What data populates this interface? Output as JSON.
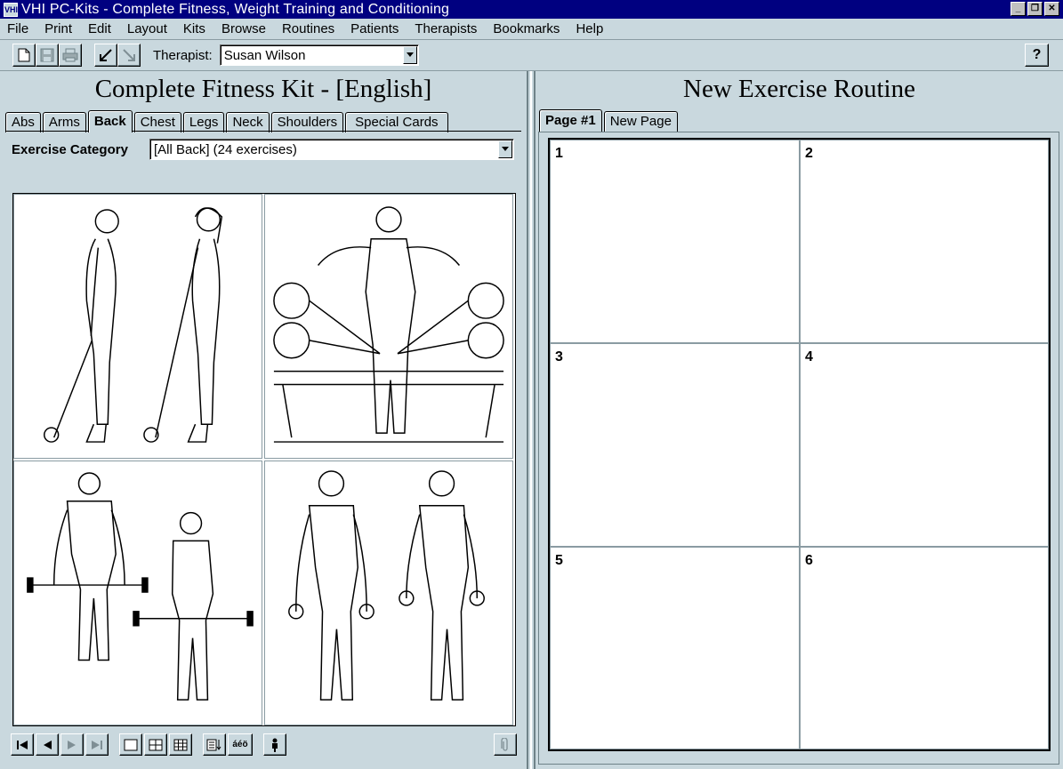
{
  "window": {
    "title": "VHI PC-Kits - Complete Fitness, Weight Training and Conditioning",
    "app_icon_text": "VHI"
  },
  "menu": [
    "File",
    "Print",
    "Edit",
    "Layout",
    "Kits",
    "Browse",
    "Routines",
    "Patients",
    "Therapists",
    "Bookmarks",
    "Help"
  ],
  "toolbar": {
    "therapist_label": "Therapist:",
    "therapist_value": "Susan Wilson",
    "help_label": "?"
  },
  "kit": {
    "title": "Complete Fitness Kit - [English]",
    "tabs": [
      "Abs",
      "Arms",
      "Back",
      "Chest",
      "Legs",
      "Neck",
      "Shoulders",
      "Special Cards"
    ],
    "active_tab": "Back",
    "category_label": "Exercise Category",
    "category_value": "[All Back] (24 exercises)"
  },
  "routine": {
    "title": "New Exercise Routine",
    "tabs": [
      "Page #1",
      "New Page"
    ],
    "active_tab": "Page #1",
    "slots": [
      "1",
      "2",
      "3",
      "4",
      "5",
      "6"
    ]
  }
}
